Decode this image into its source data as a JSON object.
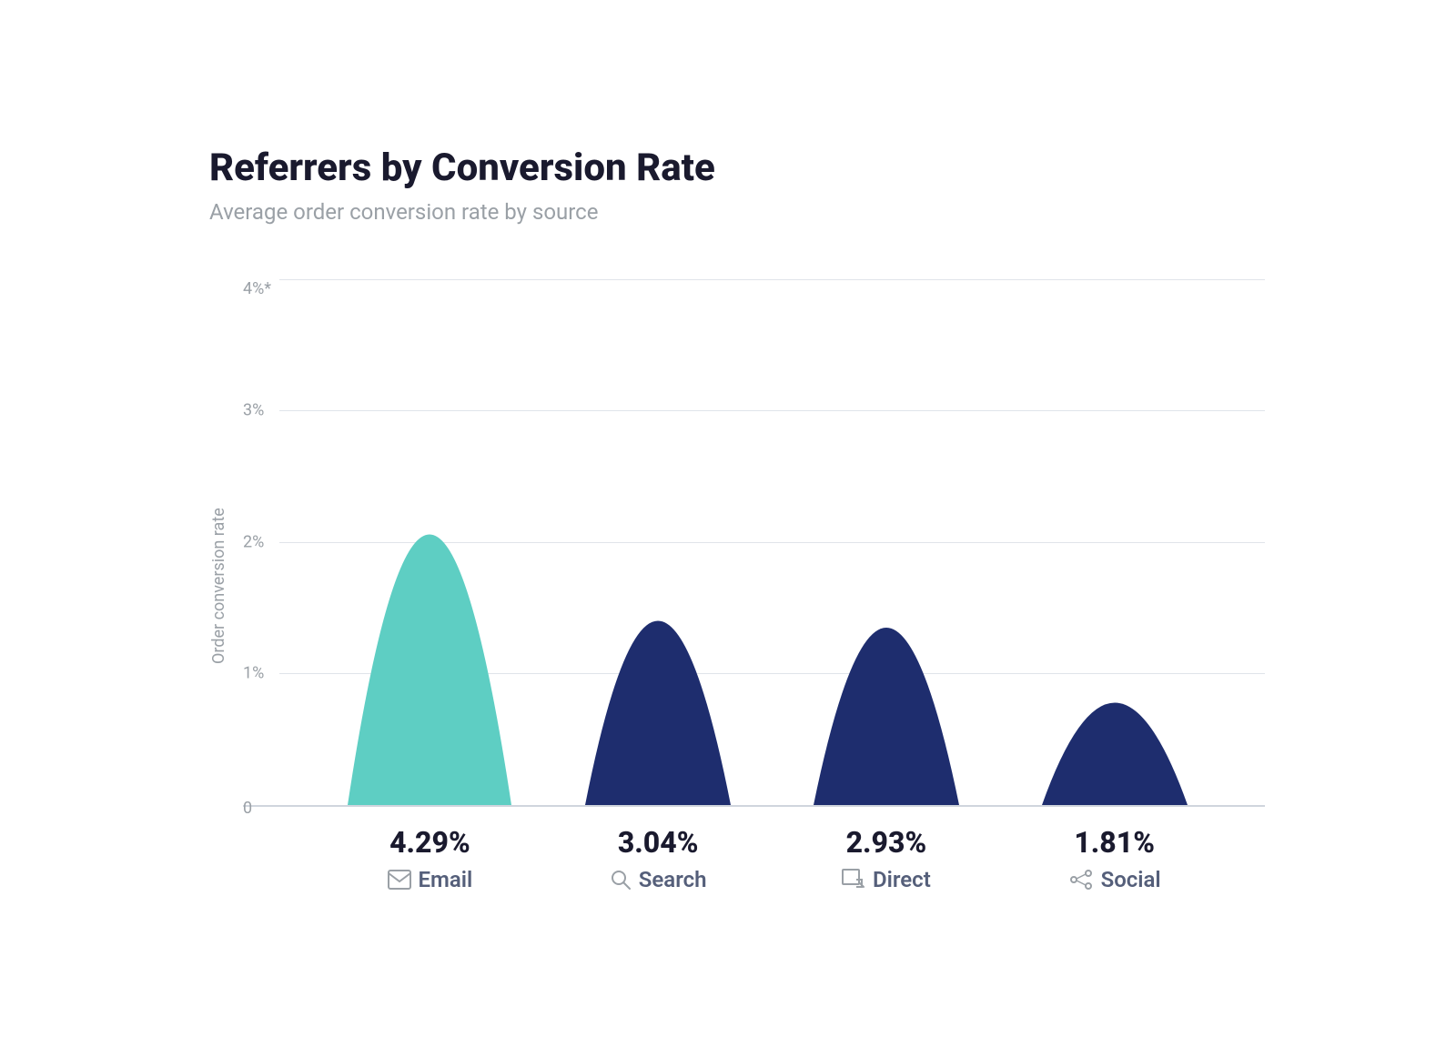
{
  "chart": {
    "title": "Referrers by Conversion Rate",
    "subtitle": "Average order conversion rate by source",
    "y_axis_label": "Order conversion rate",
    "y_axis_ticks": [
      {
        "label": "4%*",
        "pct": 100
      },
      {
        "label": "3%",
        "pct": 75
      },
      {
        "label": "2%",
        "pct": 50
      },
      {
        "label": "1%",
        "pct": 25
      },
      {
        "label": "0",
        "pct": 0
      }
    ],
    "bars": [
      {
        "id": "email",
        "label": "Email",
        "percentage": "4.29%",
        "color": "#5ecec3",
        "height_pct": 97,
        "icon": "✉",
        "icon_name": "email-icon"
      },
      {
        "id": "search",
        "label": "Search",
        "percentage": "3.04%",
        "color": "#1e2d6e",
        "height_pct": 68,
        "icon": "🔍",
        "icon_name": "search-icon"
      },
      {
        "id": "direct",
        "label": "Direct",
        "percentage": "2.93%",
        "color": "#1e2d6e",
        "height_pct": 65,
        "icon": "⊡",
        "icon_name": "direct-icon"
      },
      {
        "id": "social",
        "label": "Social",
        "percentage": "1.81%",
        "color": "#1e2d6e",
        "height_pct": 38,
        "icon": "⸺",
        "icon_name": "social-icon"
      }
    ]
  }
}
